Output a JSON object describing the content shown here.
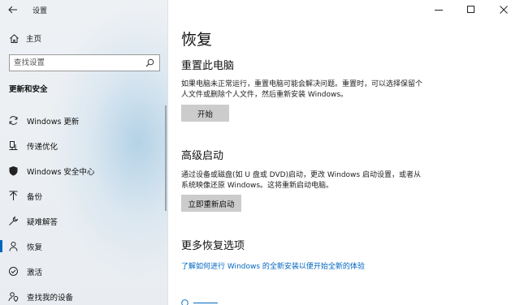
{
  "app": {
    "title": "设置"
  },
  "window_controls": {
    "minimize": "minimize-icon",
    "maximize": "maximize-icon",
    "close": "close-icon"
  },
  "sidebar": {
    "home_label": "主页",
    "search_placeholder": "查找设置",
    "section_heading": "更新和安全",
    "items": [
      {
        "label": "Windows 更新",
        "icon": "refresh-icon"
      },
      {
        "label": "传递优化",
        "icon": "delivery-optimization-icon"
      },
      {
        "label": "Windows 安全中心",
        "icon": "shield-icon"
      },
      {
        "label": "备份",
        "icon": "upload-arrow-icon"
      },
      {
        "label": "疑难解答",
        "icon": "wrench-icon"
      },
      {
        "label": "恢复",
        "icon": "recovery-icon",
        "active": true
      },
      {
        "label": "激活",
        "icon": "check-circle-icon"
      },
      {
        "label": "查找我的设备",
        "icon": "person-location-icon"
      }
    ]
  },
  "main": {
    "title": "恢复",
    "reset": {
      "heading": "重置此电脑",
      "description": "如果电脑未正常运行，重置电脑可能会解决问题。重置时，可以选择保留个人文件或删除个人文件，然后重新安装 Windows。",
      "button": "开始"
    },
    "advanced": {
      "heading": "高级启动",
      "description": "通过设备或磁盘(如 U 盘或 DVD)启动，更改 Windows 启动设置，或者从系统映像还原 Windows。这将重新启动电脑。",
      "button": "立即重新启动"
    },
    "more": {
      "heading": "更多恢复选项",
      "link": "了解如何进行 Windows 的全新安装以便开始全新的体验"
    }
  },
  "colors": {
    "accent": "#0067c0",
    "button_bg": "#cccccc"
  }
}
